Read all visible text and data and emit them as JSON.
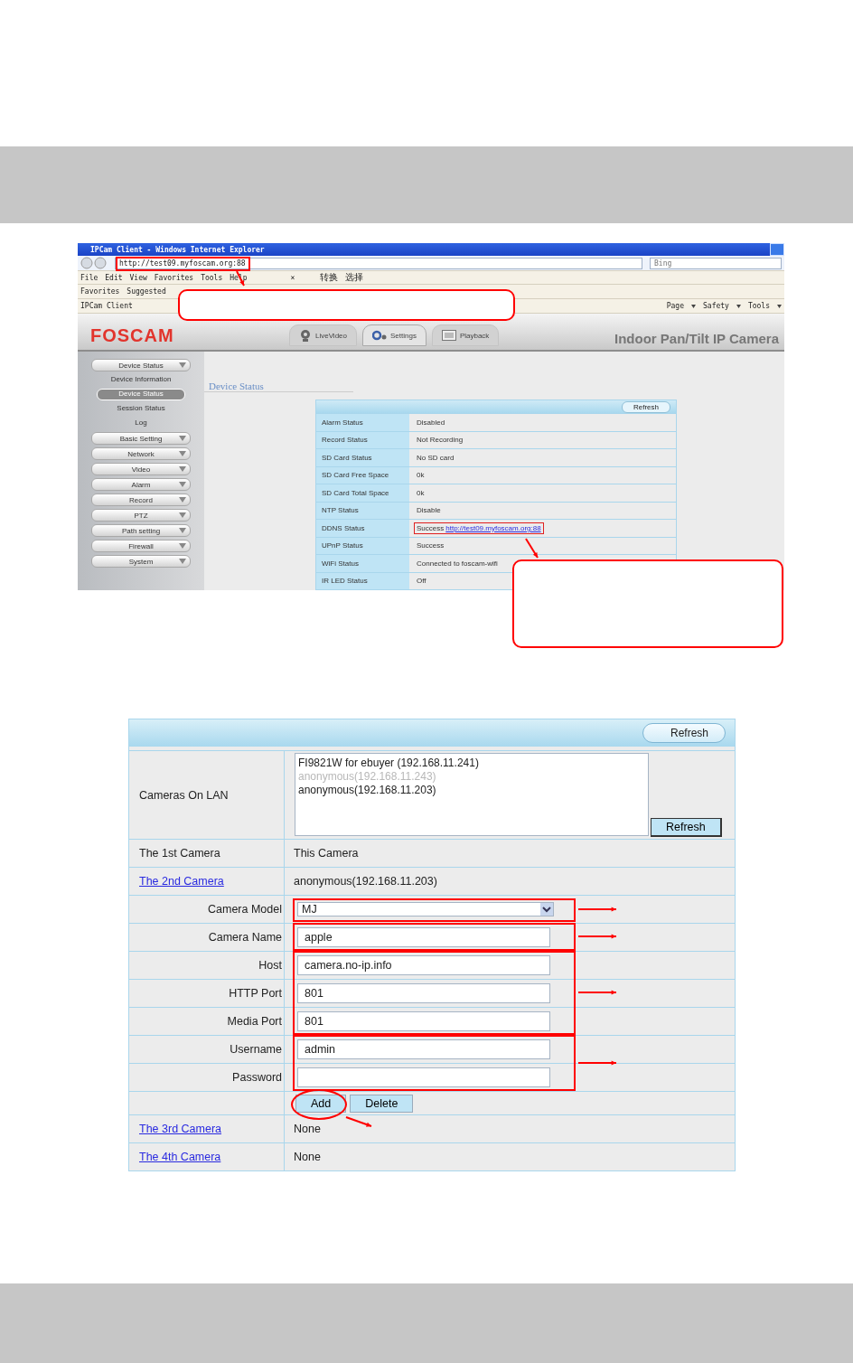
{
  "browser": {
    "title": "IPCam Client - Windows Internet Explorer",
    "address": "http://test09.myfoscam.org:88",
    "search_placeholder": "Bing",
    "menu": [
      "File",
      "Edit",
      "View",
      "Favorites",
      "Tools",
      "Help"
    ],
    "close_mark": "×",
    "toolbar_items": [
      "转换",
      "选择"
    ],
    "favorites": [
      "Favorites",
      "Suggested"
    ],
    "tab": "IPCam Client",
    "commands": [
      "Page",
      "Safety",
      "Tools"
    ]
  },
  "app": {
    "logo": "FOSCAM",
    "nav": [
      {
        "label": "LiveVideo",
        "selected": false,
        "kind": "camera"
      },
      {
        "label": "Settings",
        "selected": true,
        "kind": "gears"
      },
      {
        "label": "Playback",
        "selected": false,
        "kind": "film"
      }
    ],
    "product": "Indoor Pan/Tilt IP Camera",
    "sidebar": [
      {
        "label": "Device Status",
        "children": [
          {
            "label": "Device Information",
            "selected": false
          },
          {
            "label": "Device Status",
            "selected": true
          },
          {
            "label": "Session Status",
            "selected": false
          },
          {
            "label": "Log",
            "selected": false
          }
        ]
      },
      {
        "label": "Basic Setting"
      },
      {
        "label": "Network"
      },
      {
        "label": "Video"
      },
      {
        "label": "Alarm"
      },
      {
        "label": "Record"
      },
      {
        "label": "PTZ"
      },
      {
        "label": "Path setting"
      },
      {
        "label": "Firewall"
      },
      {
        "label": "System"
      }
    ],
    "page_title": "Device Status",
    "refresh": "Refresh",
    "status_rows": [
      {
        "label": "Alarm Status",
        "value": "Disabled"
      },
      {
        "label": "Record Status",
        "value": "Not Recording"
      },
      {
        "label": "SD Card Status",
        "value": "No SD card"
      },
      {
        "label": "SD Card Free Space",
        "value": "0k"
      },
      {
        "label": "SD Card Total Space",
        "value": "0k"
      },
      {
        "label": "NTP Status",
        "value": "Disable"
      },
      {
        "label": "DDNS Status",
        "value": "Success",
        "link": "http://test09.myfoscam.org:88",
        "highlighted": true
      },
      {
        "label": "UPnP Status",
        "value": "Success"
      },
      {
        "label": "WiFi Status",
        "value": "Connected to foscam-wifi"
      },
      {
        "label": "IR LED Status",
        "value": "Off"
      }
    ]
  },
  "camera_settings": {
    "refresh": "Refresh",
    "rows": [
      {
        "kind": "list",
        "label": "Cameras On LAN",
        "items": [
          {
            "text": "FI9821W for ebuyer (192.168.11.241)",
            "disabled": false
          },
          {
            "text": "anonymous(192.168.11.243)",
            "disabled": true
          },
          {
            "text": "anonymous(192.168.11.203)",
            "disabled": false
          }
        ],
        "button": "Refresh"
      },
      {
        "kind": "text",
        "label": "The 1st Camera",
        "link": false,
        "value": "This Camera"
      },
      {
        "kind": "text",
        "label": "The 2nd Camera",
        "link": true,
        "value": "anonymous(192.168.11.203)"
      },
      {
        "kind": "select",
        "label": "Camera Model",
        "value": "MJ"
      },
      {
        "kind": "input",
        "label": "Camera Name",
        "value": "apple"
      },
      {
        "kind": "input",
        "label": "Host",
        "value": "camera.no-ip.info"
      },
      {
        "kind": "input",
        "label": "HTTP Port",
        "value": "801"
      },
      {
        "kind": "input",
        "label": "Media Port",
        "value": "801"
      },
      {
        "kind": "input",
        "label": "Username",
        "value": "admin"
      },
      {
        "kind": "input",
        "label": "Password",
        "value": ""
      },
      {
        "kind": "buttons",
        "buttons": [
          "Add",
          "Delete"
        ]
      },
      {
        "kind": "text",
        "label": "The 3rd Camera",
        "link": true,
        "value": "None"
      },
      {
        "kind": "text",
        "label": "The 4th Camera",
        "link": true,
        "value": "None"
      }
    ]
  }
}
